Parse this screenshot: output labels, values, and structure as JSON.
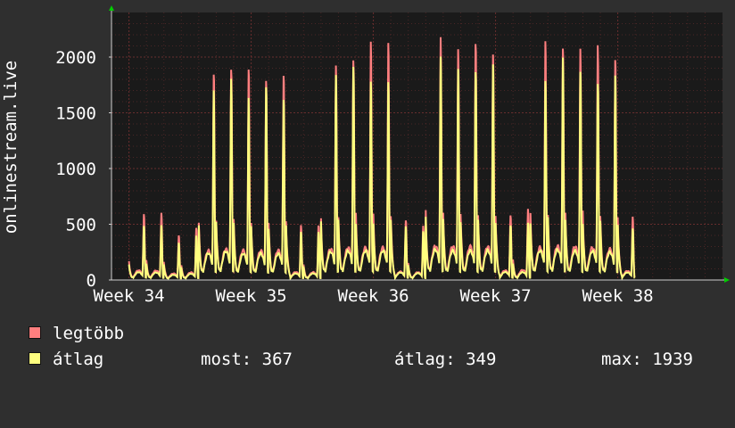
{
  "chart_data": {
    "type": "line",
    "ylabel": "onlinestream.live",
    "ylim": [
      0,
      2400
    ],
    "y_ticks": [
      0,
      500,
      1000,
      1500,
      2000
    ],
    "x_tick_labels": [
      "Week 34",
      "Week 35",
      "Week 36",
      "Week 37",
      "Week 38"
    ],
    "x_range_days": [
      0,
      35
    ],
    "grid": true,
    "colors": {
      "legtobb": "#ff7f7f",
      "atlag": "#ffff7f",
      "background": "#2f2f2f",
      "plot_background": "#1a1a1a",
      "grid": "#703030",
      "axis_arrow": "#00cc00"
    },
    "series": [
      {
        "name": "legtöbb",
        "color": "#ff7f7f",
        "daily_peak": [
          620,
          600,
          420,
          490,
          1880,
          1980,
          1900,
          1880,
          1900,
          510,
          500,
          2000,
          2070,
          2080,
          2080,
          540,
          500,
          2190,
          2160,
          2150,
          2130,
          610,
          640,
          2090,
          2170,
          2150,
          2080,
          1990,
          580
        ]
      },
      {
        "name": "átlag",
        "color": "#ffff7f",
        "daily_peak": [
          500,
          480,
          330,
          400,
          1720,
          1840,
          1690,
          1700,
          1680,
          420,
          420,
          1810,
          1860,
          1870,
          1870,
          480,
          440,
          1950,
          1880,
          1880,
          1900,
          510,
          500,
          1880,
          1940,
          1870,
          1850,
          1790,
          480
        ]
      }
    ]
  },
  "legend": {
    "max_label": "legtöbb",
    "avg_label": "átlag"
  },
  "stats": {
    "now": "most: 367",
    "avg": "átlag: 349",
    "max": "max: 1939"
  }
}
